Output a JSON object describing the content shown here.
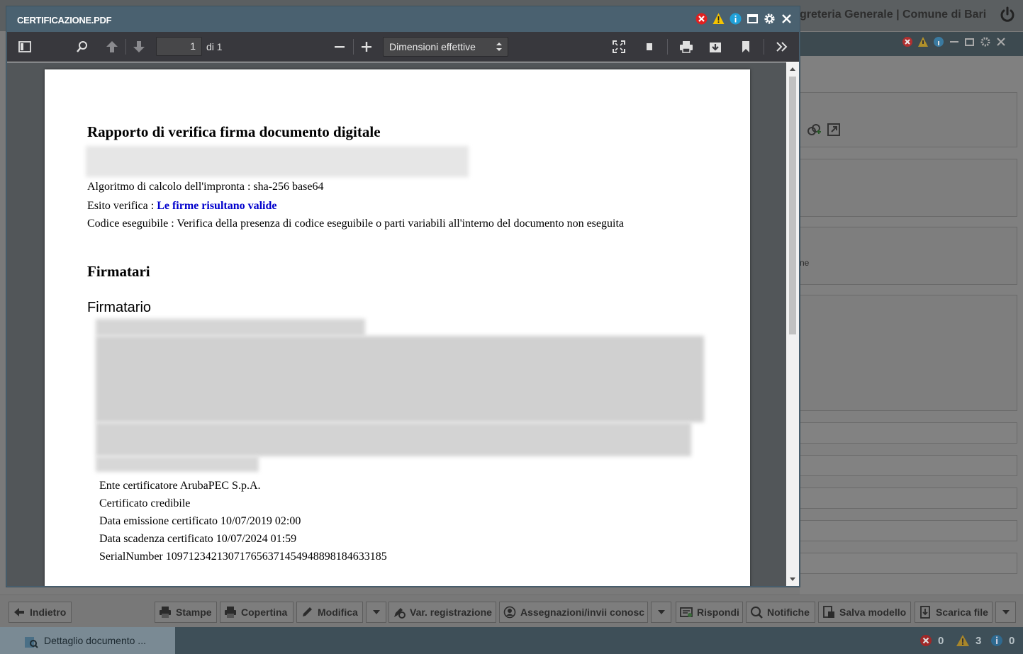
{
  "background_app": {
    "header_title": "greteria Generale | Comune di Bari",
    "panel_fragment": "ne"
  },
  "modal": {
    "title": "CERTIFICAZIONE.PDF",
    "controls": [
      "error-icon",
      "warning-icon",
      "info-icon",
      "maximize-icon",
      "gear-icon",
      "close-icon"
    ]
  },
  "pdf_toolbar": {
    "page_current": "1",
    "page_total_label": "di 1",
    "zoom_selected": "Dimensioni effettive"
  },
  "document": {
    "title": "Rapporto di verifica firma documento digitale",
    "algorithm_line": "Algoritmo di calcolo dell'impronta : sha-256 base64",
    "esito_label": "Esito verifica : ",
    "esito_value": "Le firme risultano valide",
    "codice_line": "Codice eseguibile : Verifica della presenza di codice eseguibile o parti variabili all'interno del documento non eseguita",
    "signers_heading": "Firmatari",
    "signer_heading": "Firmatario",
    "signer_details": [
      "Ente certificatore ArubaPEC S.p.A.",
      "Certificato credibile",
      "Data emissione certificato 10/07/2019 02:00",
      "Data scadenza certificato 10/07/2024 01:59",
      "SerialNumber 109712342130717656371454948898184633185"
    ]
  },
  "bottom_toolbar": {
    "back": "Indietro",
    "stampe": "Stampe",
    "copertina": "Copertina",
    "modifica": "Modifica",
    "var_registrazione": "Var. registrazione",
    "assegnazioni": "Assegnazioni/invii conosc",
    "rispondi": "Rispondi",
    "notifiche": "Notifiche",
    "salva_modello": "Salva modello",
    "scarica_file": "Scarica file"
  },
  "taskbar": {
    "active_task": "Dettaglio documento ...",
    "errors_count": "0",
    "warnings_count": "3",
    "info_count": "0"
  },
  "colors": {
    "modal_header": "#4a6170",
    "pdf_toolbar": "#38383d",
    "valid_text": "#0000cc",
    "taskbar": "#3e4f58"
  }
}
